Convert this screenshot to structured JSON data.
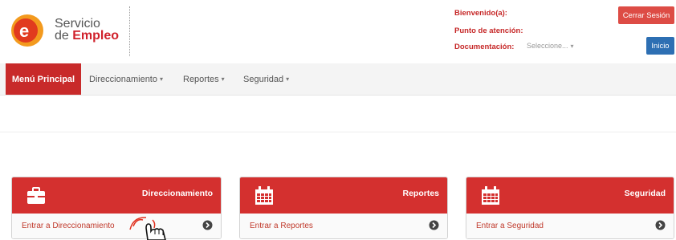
{
  "logo": {
    "line1": "Servicio",
    "line2_prefix": "de ",
    "line2_bold": "Empleo",
    "icon": "servicio-empleo-logo-icon"
  },
  "header": {
    "welcome_label": "Bienvenido(a):",
    "attention_label": "Punto de atención:",
    "documentation_label": "Documentación:",
    "documentation_placeholder": "Seleccione...",
    "logout_button": "Cerrar Sesión",
    "home_button": "Inicio"
  },
  "nav": {
    "items": [
      {
        "label": "Menú Principal",
        "active": true
      },
      {
        "label": "Direccionamiento",
        "dropdown": true
      },
      {
        "label": "Reportes",
        "dropdown": true
      },
      {
        "label": "Seguridad",
        "dropdown": true
      }
    ]
  },
  "cards": [
    {
      "title": "Direccionamiento",
      "link": "Entrar a Direccionamiento",
      "icon": "briefcase-icon"
    },
    {
      "title": "Reportes",
      "link": "Entrar a Reportes",
      "icon": "calendar-icon"
    },
    {
      "title": "Seguridad",
      "link": "Entrar a Seguridad",
      "icon": "calendar-icon"
    }
  ],
  "colors": {
    "brand_red": "#d4302f",
    "nav_active": "#c82a2a",
    "logout_button": "#dd4c45",
    "home_button": "#2d6fb3",
    "header_text_red": "#c62828"
  }
}
